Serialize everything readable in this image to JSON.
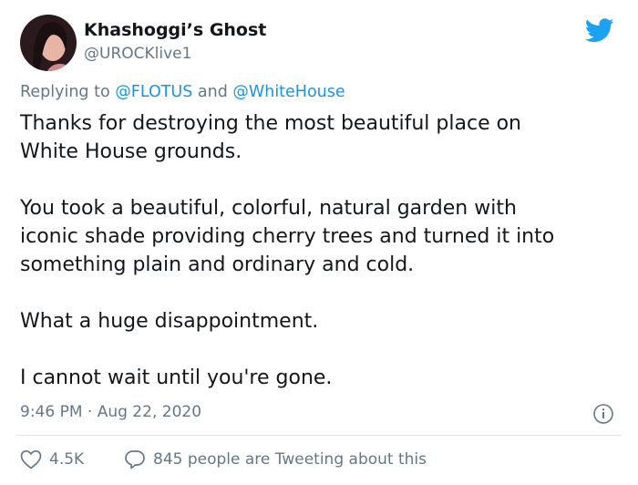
{
  "author": {
    "display_name": "Khashoggi’s Ghost",
    "handle": "@UROCKlive1"
  },
  "reply": {
    "prefix": "Replying to",
    "mention1": "@FLOTUS",
    "joiner": "and",
    "mention2": "@WhiteHouse"
  },
  "tweet": {
    "lines": [
      "Thanks for destroying the most beautiful place on",
      "White House grounds.",
      "You took a beautiful, colorful, natural garden with",
      "iconic shade providing cherry trees and turned it into",
      "something plain and ordinary and cold.",
      "What a huge disappointment.",
      "I cannot wait until you're gone."
    ]
  },
  "meta": {
    "timestamp": "9:46 PM · Aug 22, 2020"
  },
  "actions": {
    "likes": "4.5K",
    "tweeting_about": "845 people are Tweeting about this"
  },
  "colors": {
    "twitter_blue": "#1da1f2",
    "secondary_text": "#657786",
    "mention": "#1b95e0"
  }
}
